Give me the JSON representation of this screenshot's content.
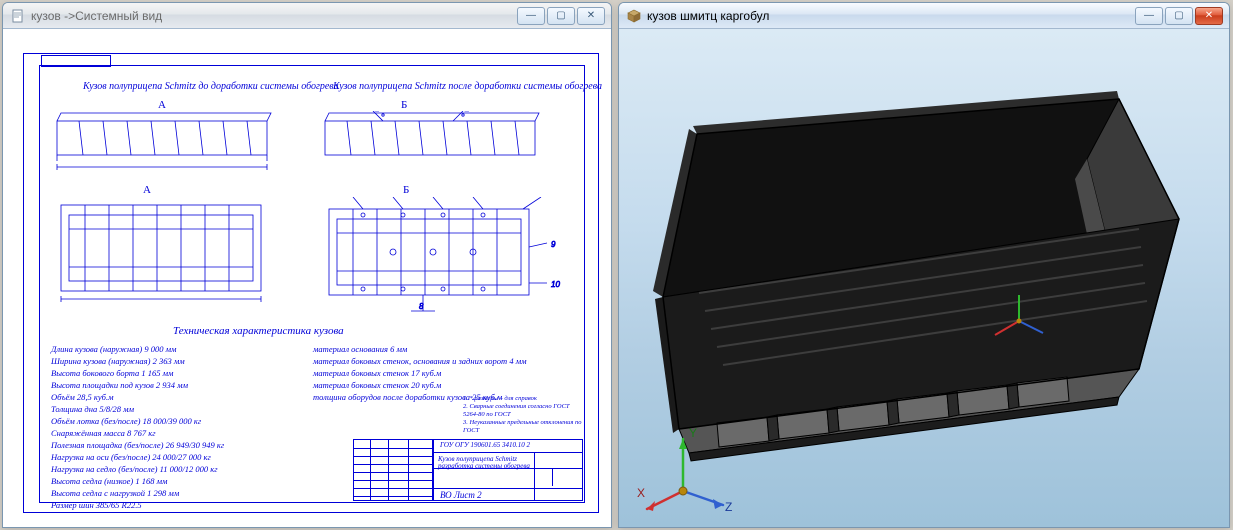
{
  "windows": {
    "left": {
      "title": "кузов ->Системный вид",
      "icon": "document-icon",
      "buttons": {
        "min": "—",
        "max": "▢",
        "close": "✕"
      }
    },
    "right": {
      "title": "кузов шмитц каргобул",
      "icon": "cube-icon",
      "buttons": {
        "min": "—",
        "max": "▢",
        "close": "✕"
      }
    }
  },
  "drawing": {
    "title_left": "Кузов полуприцепа Schmitz  до доработки системы обогрева",
    "title_right": "Кузов полуприцепа Schmitz  после доработки системы обогрева",
    "labels": {
      "A": "А",
      "B": "Б",
      "A_section": "А",
      "B_section": "Б"
    },
    "tech_title": "Техническая характеристика кузова",
    "specs_left": [
      "Длина кузова (наружная)   9 000 мм",
      "Ширина кузова (наружная)   2 363 мм",
      "Высота бокового борта  1 165 мм",
      "Высота площадки под кузов  2 934 мм",
      "Объём   28,5 куб.м",
      "Толщина дна  5/8/28 мм",
      "Объём лотка (без/после)   18 000/39 000 кг",
      "Снаряжённая масса  8 767 кг",
      "Полезная площадка (без/после)   26 949/30 949 кг",
      "Нагрузка на оси (без/после)   24 000/27 000 кг",
      "Нагрузка на седло (без/после)   11 000/12 000 кг",
      "Высота седла (низкое)   1 168 мм",
      "Высота седла с нагрузкой  1 298 мм",
      "Размер шин   385/65 R22.5"
    ],
    "specs_right": [
      "материал основания   6 мм",
      "материал боковых стенок, основания и задних ворот  4 мм",
      "материал боковых стенок  17 куб.м",
      "материал боковых стенок   20 куб.м",
      "толщина оборудов после доработки кузова  25 куб.м"
    ],
    "notes": [
      "1. * размеры – для справок",
      "2. Сварные соединения согласно ГОСТ 5264-80 по ГОСТ",
      "3. Неуказанные предельные отклонения по ГОСТ"
    ],
    "titleblock": {
      "org": "ГОУ ОГУ 190601.65 3410.10 2",
      "name": "Кузов полуприцепа Schmitz",
      "desc": "разработка системы обогрева",
      "sheet": "ВО  Лист  2"
    }
  },
  "viewport": {
    "axes": {
      "x": "X",
      "y": "Y",
      "z": "Z"
    }
  }
}
